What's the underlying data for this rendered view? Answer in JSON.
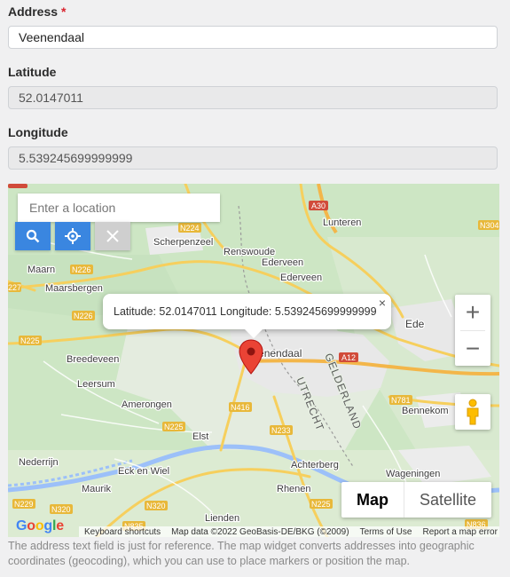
{
  "form": {
    "address_label": "Address",
    "required_mark": "*",
    "address_value": "Veenendaal",
    "latitude_label": "Latitude",
    "latitude_value": "52.0147011",
    "longitude_label": "Longitude",
    "longitude_value": "5.539245699999999"
  },
  "map": {
    "search_placeholder": "Enter a location",
    "buttons": {
      "search": "search-icon",
      "locate": "crosshair-icon",
      "clear": "close-icon"
    },
    "popup_text": "Latitude: 52.0147011 Longitude: 5.539245699999999",
    "popup_close": "×",
    "zoom_in": "+",
    "zoom_out": "−",
    "maptype_map": "Map",
    "maptype_satellite": "Satellite",
    "google": "Google",
    "attribution": {
      "shortcuts": "Keyboard shortcuts",
      "data": "Map data ©2022 GeoBasis-DE/BKG (©2009)",
      "terms": "Terms of Use",
      "report": "Report a map error"
    },
    "places": {
      "lunteren": "Lunteren",
      "scherpenzeel": "Scherpenzeel",
      "renswoude": "Renswoude",
      "ederveen": "Ederveen",
      "maarn": "Maarn",
      "maarsbergen": "Maarsbergen",
      "ede": "Ede",
      "veenendaal": "Veenendaal",
      "breedeveen": "Breedeveen",
      "leersum": "Leersum",
      "amerongen": "Amerongen",
      "elst": "Elst",
      "eck_en_wiel": "Eck en Wiel",
      "maurik": "Maurik",
      "achterberg": "Achterberg",
      "rhenen": "Rhenen",
      "wageningen": "Wageningen",
      "bennekom": "Bennekom",
      "lienden": "Lienden",
      "nederrijn": "Nederrijn",
      "gelderland": "GELDERLAND",
      "utrecht": "UTRECHT"
    },
    "roads": [
      "A30",
      "N224",
      "N226",
      "N226",
      "N227",
      "N225",
      "N416",
      "N233",
      "A12",
      "N781",
      "N304",
      "N225",
      "N320",
      "N229",
      "N320",
      "N835",
      "N836",
      "N225"
    ]
  },
  "help_text": "The address text field is just for reference. The map widget converts addresses into geographic coordinates (geocoding), which you can use to place markers or position the map."
}
